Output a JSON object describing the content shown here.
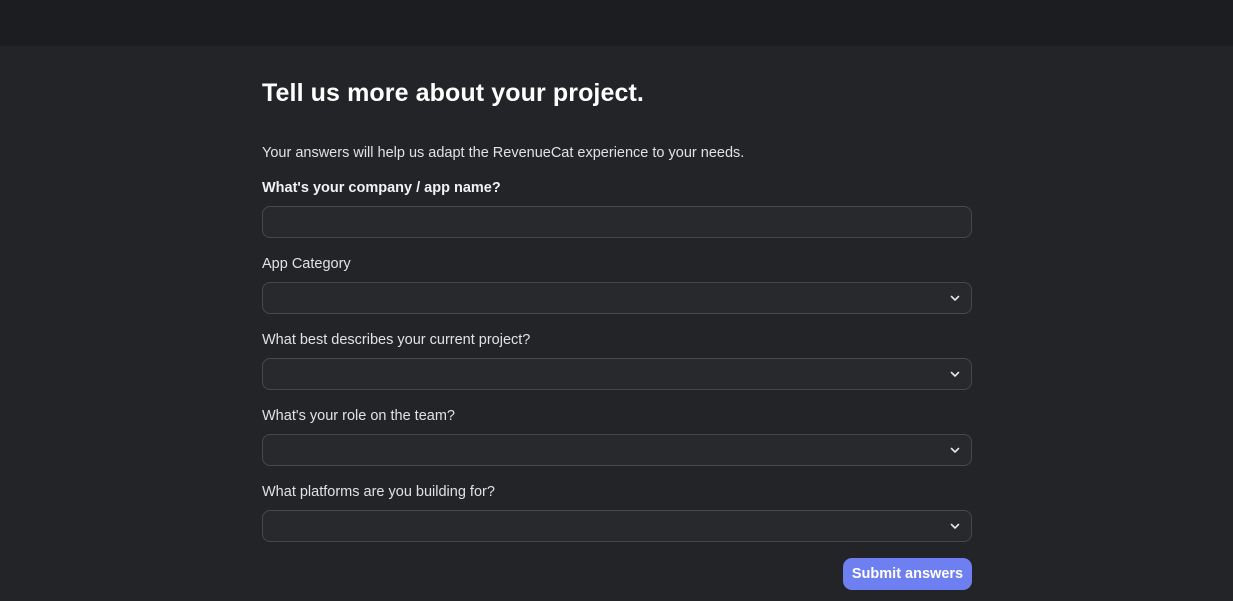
{
  "form": {
    "title": "Tell us more about your project.",
    "subtitle": "Your answers will help us adapt the RevenueCat experience to your needs.",
    "company": {
      "label": "What's your company / app name?",
      "value": "",
      "placeholder": ""
    },
    "category": {
      "label": "App Category",
      "value": ""
    },
    "project": {
      "label": "What best describes your current project?",
      "value": ""
    },
    "role": {
      "label": "What's your role on the team?",
      "value": ""
    },
    "platforms": {
      "label": "What platforms are you building for?",
      "value": ""
    },
    "submit_label": "Submit answers"
  },
  "icons": {
    "select_chevron": "chevron-down-icon"
  },
  "colors": {
    "background": "#232427",
    "topbar": "#1c1d20",
    "accent": "#6e7ff1",
    "field_bg": "#28292c",
    "field_border": "#47484c"
  }
}
